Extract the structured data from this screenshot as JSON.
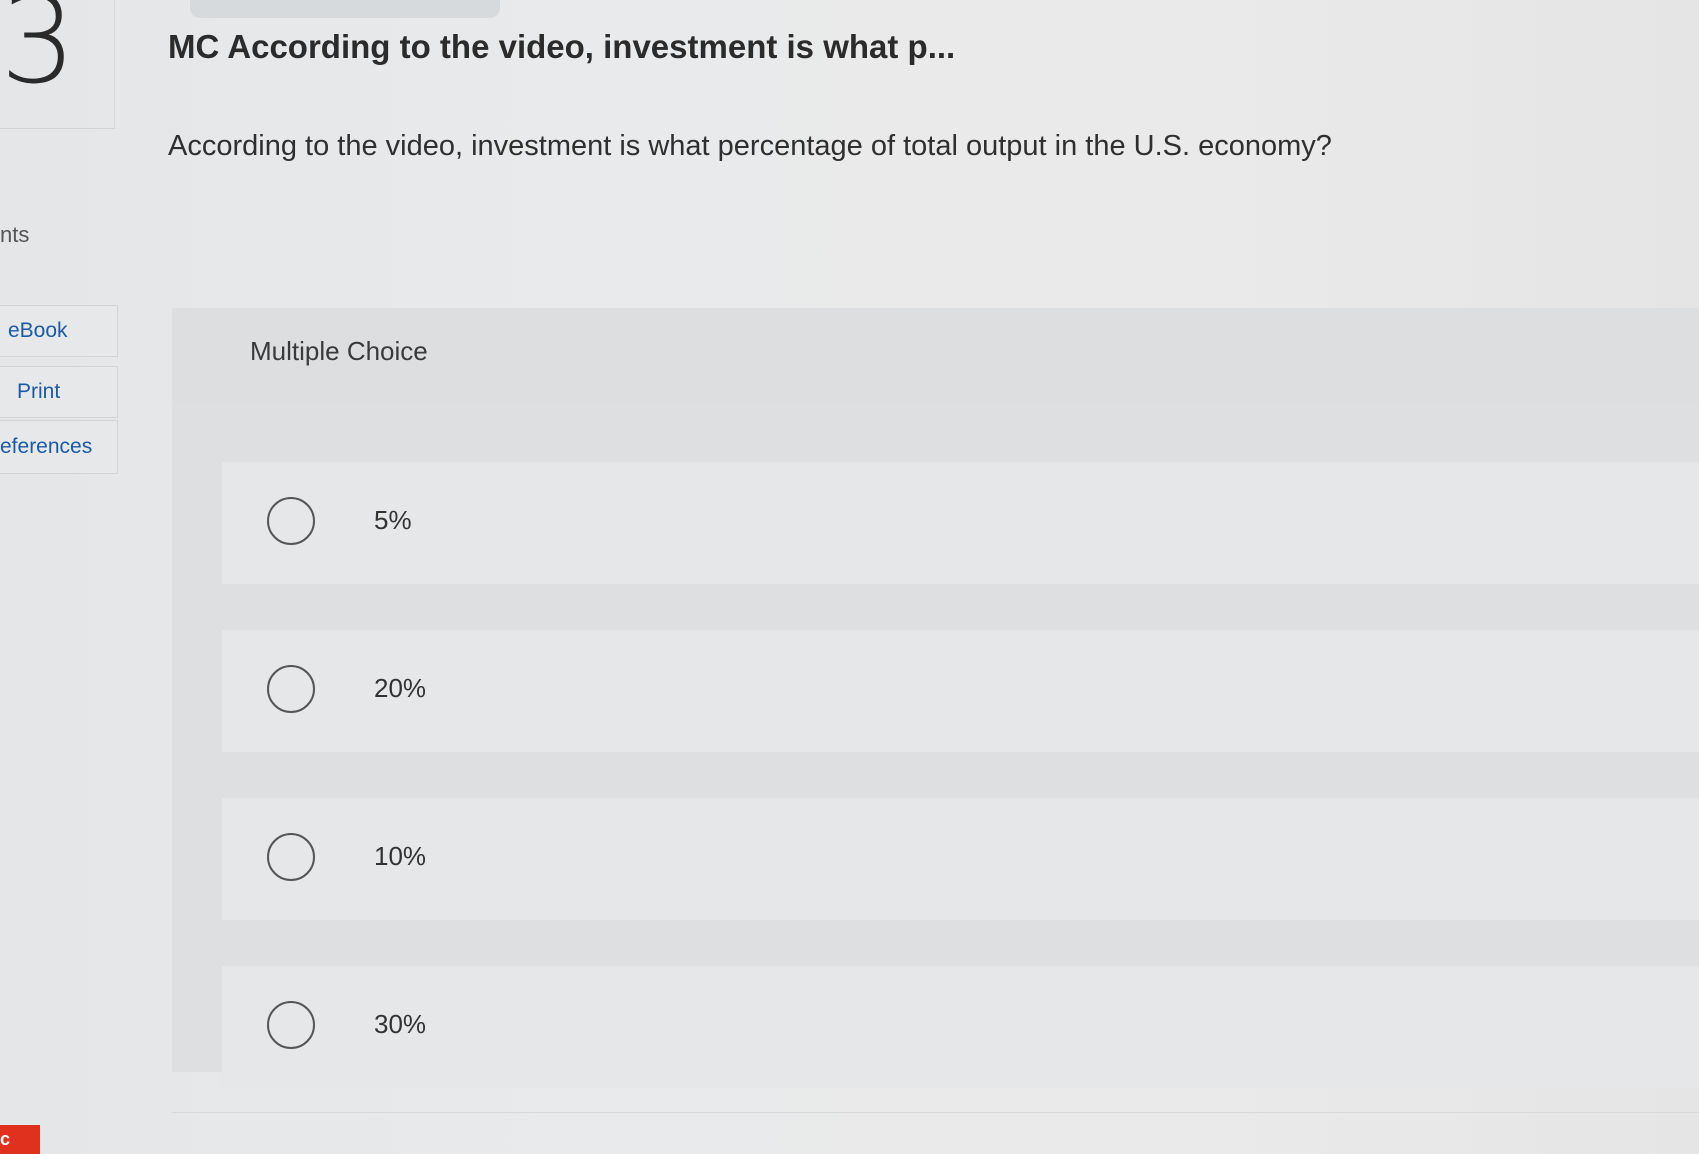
{
  "rail": {
    "question_number": "3",
    "points_fragment": "nts",
    "buttons": {
      "ebook": "eBook",
      "print": "Print",
      "references": "eferences"
    },
    "corner_glyph": "c"
  },
  "question": {
    "title": "MC According to the video, investment is what p...",
    "prompt": "According to the video, investment is what percentage of total output in the U.S. economy?"
  },
  "choices": {
    "label": "Multiple Choice",
    "options": [
      {
        "text": "5%",
        "selected": false
      },
      {
        "text": "20%",
        "selected": false
      },
      {
        "text": "10%",
        "selected": false
      },
      {
        "text": "30%",
        "selected": false
      }
    ]
  },
  "colors": {
    "link": "#1b5ba6",
    "accent_red": "#e0311e"
  }
}
